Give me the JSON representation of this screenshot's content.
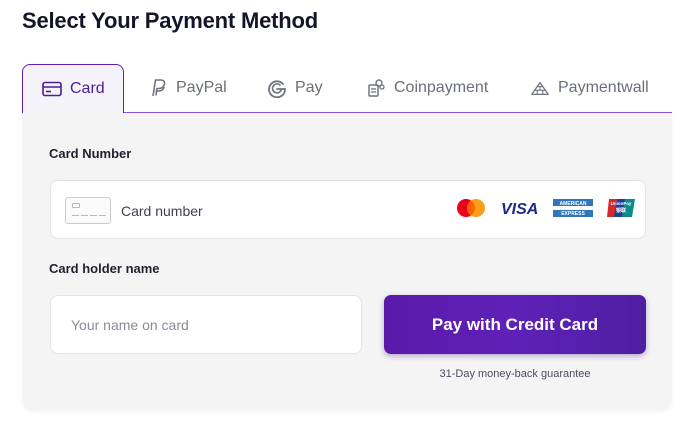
{
  "page": {
    "title": "Select Your Payment Method"
  },
  "tabs": [
    {
      "label": "Card",
      "icon": "credit-card-icon",
      "active": true
    },
    {
      "label": "PayPal",
      "icon": "paypal-icon",
      "active": false
    },
    {
      "label": "Pay",
      "icon": "google-pay-icon",
      "active": false
    },
    {
      "label": "Coinpayment",
      "icon": "coinpayment-icon",
      "active": false
    },
    {
      "label": "Paymentwall",
      "icon": "paymentwall-icon",
      "active": false
    }
  ],
  "form": {
    "card_number_label": "Card Number",
    "card_number_placeholder": "Card number",
    "card_brands": [
      {
        "name": "mastercard-icon"
      },
      {
        "name": "visa-icon",
        "text": "VISA"
      },
      {
        "name": "american-express-icon",
        "text": "AMERICAN EXPRESS"
      },
      {
        "name": "unionpay-icon",
        "text": "UnionPay"
      }
    ],
    "holder_label": "Card holder name",
    "holder_placeholder": "Your name on card",
    "pay_button": "Pay with Credit Card",
    "guarantee": "31-Day money-back guarantee"
  },
  "colors": {
    "accent": "#5b21b6",
    "panel_bg": "#f4f4f5",
    "tab_active_text": "#4c1d95"
  }
}
